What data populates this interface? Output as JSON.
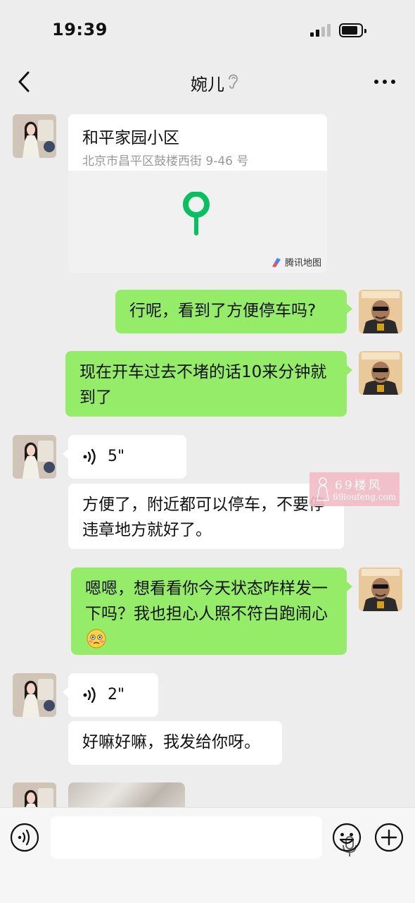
{
  "status_bar": {
    "time": "19:39"
  },
  "nav": {
    "title": "婉儿"
  },
  "messages": {
    "location": {
      "name": "和平家园小区",
      "address": "北京市昌平区鼓楼西街 9-46 号",
      "provider": "腾讯地图"
    },
    "out1": "行呢，看到了方便停车吗?",
    "out2": "现在开车过去不堵的话10来分钟就到了",
    "voice1": "5\"",
    "in1": "方便了，附近都可以停车，不要停违章地方就好了。",
    "out3": "嗯嗯，想看看你今天状态咋样发一下吗？我也担心人照不符白跑闹心",
    "voice2": "2\"",
    "in2": "好嘛好嘛，我发给你呀。"
  },
  "watermark": {
    "line1": "69楼风",
    "line2": "69loufeng.com"
  },
  "icons": {
    "back": "chevron-left-icon",
    "ear": "ear-icon",
    "more": "more-icon",
    "voice": "voice-wave-icon",
    "mic": "microphone-icon",
    "emoji": "smiley-icon",
    "plus": "plus-circle-icon",
    "blush": "flushed-face-emoji"
  },
  "colors": {
    "outgoing_bubble": "#95ec69",
    "incoming_bubble": "#ffffff",
    "background": "#ededed",
    "map_pin": "#07c160"
  }
}
